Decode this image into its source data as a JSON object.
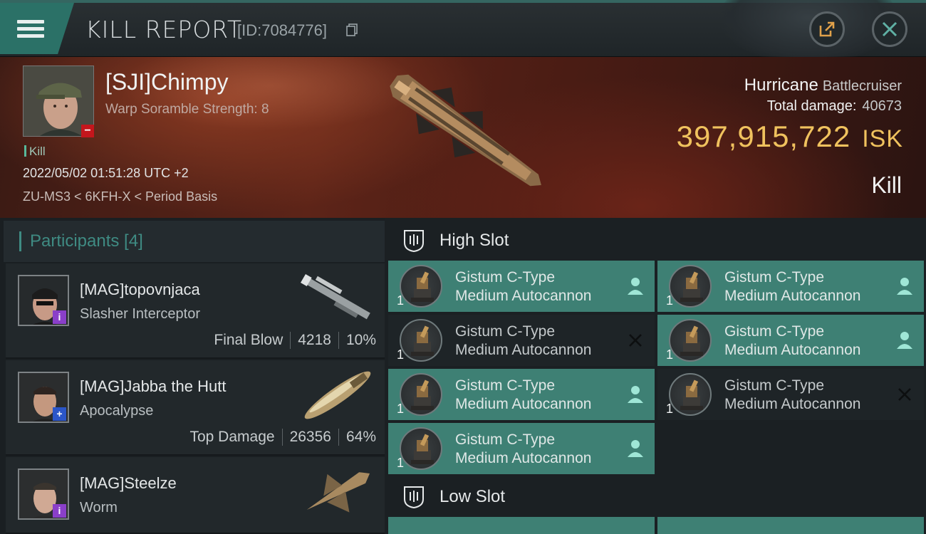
{
  "header": {
    "title": "KILL REPORT",
    "report_id": "[ID:7084776]"
  },
  "victim": {
    "name": "[SJI]Chimpy",
    "scramble": "Warp Soramble Strength: 8",
    "kill_tag": "Kill",
    "datetime": "2022/05/02 01:51:28 UTC +2",
    "location": "ZU-MS3 < 6KFH-X < Period Basis",
    "ship_name": "Hurricane",
    "ship_class": "Battlecruiser",
    "total_damage_label": "Total damage:",
    "total_damage_value": "40673",
    "isk_value": "397,915,722",
    "isk_unit": "ISK",
    "result": "Kill",
    "badge_color": "#c4161c"
  },
  "participants": {
    "header": "Participants [4]",
    "items": [
      {
        "name": "[MAG]topovnjaca",
        "ship": "Slasher Interceptor",
        "role": "Final Blow",
        "damage": "4218",
        "percent": "10%",
        "badge_color": "#8a3fc9",
        "badge_glyph": "i"
      },
      {
        "name": "[MAG]Jabba the Hutt",
        "ship": "Apocalypse",
        "role": "Top Damage",
        "damage": "26356",
        "percent": "64%",
        "badge_color": "#2b56c9",
        "badge_glyph": "+"
      },
      {
        "name": "[MAG]Steelze",
        "ship": "Worm",
        "role": "",
        "damage": "",
        "percent": "",
        "badge_color": "#8a3fc9",
        "badge_glyph": "i"
      }
    ]
  },
  "slots": {
    "high_label": "High Slot",
    "low_label": "Low Slot",
    "high_modules": [
      {
        "line1": "Gistum C-Type",
        "line2": "Medium Autocannon",
        "qty": "1",
        "status": "fitted"
      },
      {
        "line1": "Gistum C-Type",
        "line2": "Medium Autocannon",
        "qty": "1",
        "status": "fitted"
      },
      {
        "line1": "Gistum C-Type",
        "line2": "Medium Autocannon",
        "qty": "1",
        "status": "destroyed"
      },
      {
        "line1": "Gistum C-Type",
        "line2": "Medium Autocannon",
        "qty": "1",
        "status": "fitted"
      },
      {
        "line1": "Gistum C-Type",
        "line2": "Medium Autocannon",
        "qty": "1",
        "status": "fitted"
      },
      {
        "line1": "Gistum C-Type",
        "line2": "Medium Autocannon",
        "qty": "1",
        "status": "destroyed"
      },
      {
        "line1": "Gistum C-Type",
        "line2": "Medium Autocannon",
        "qty": "1",
        "status": "fitted"
      }
    ]
  },
  "colors": {
    "accent": "#3f8b83",
    "fitted_bg": "#3e8074",
    "isk": "#f0c25e"
  }
}
